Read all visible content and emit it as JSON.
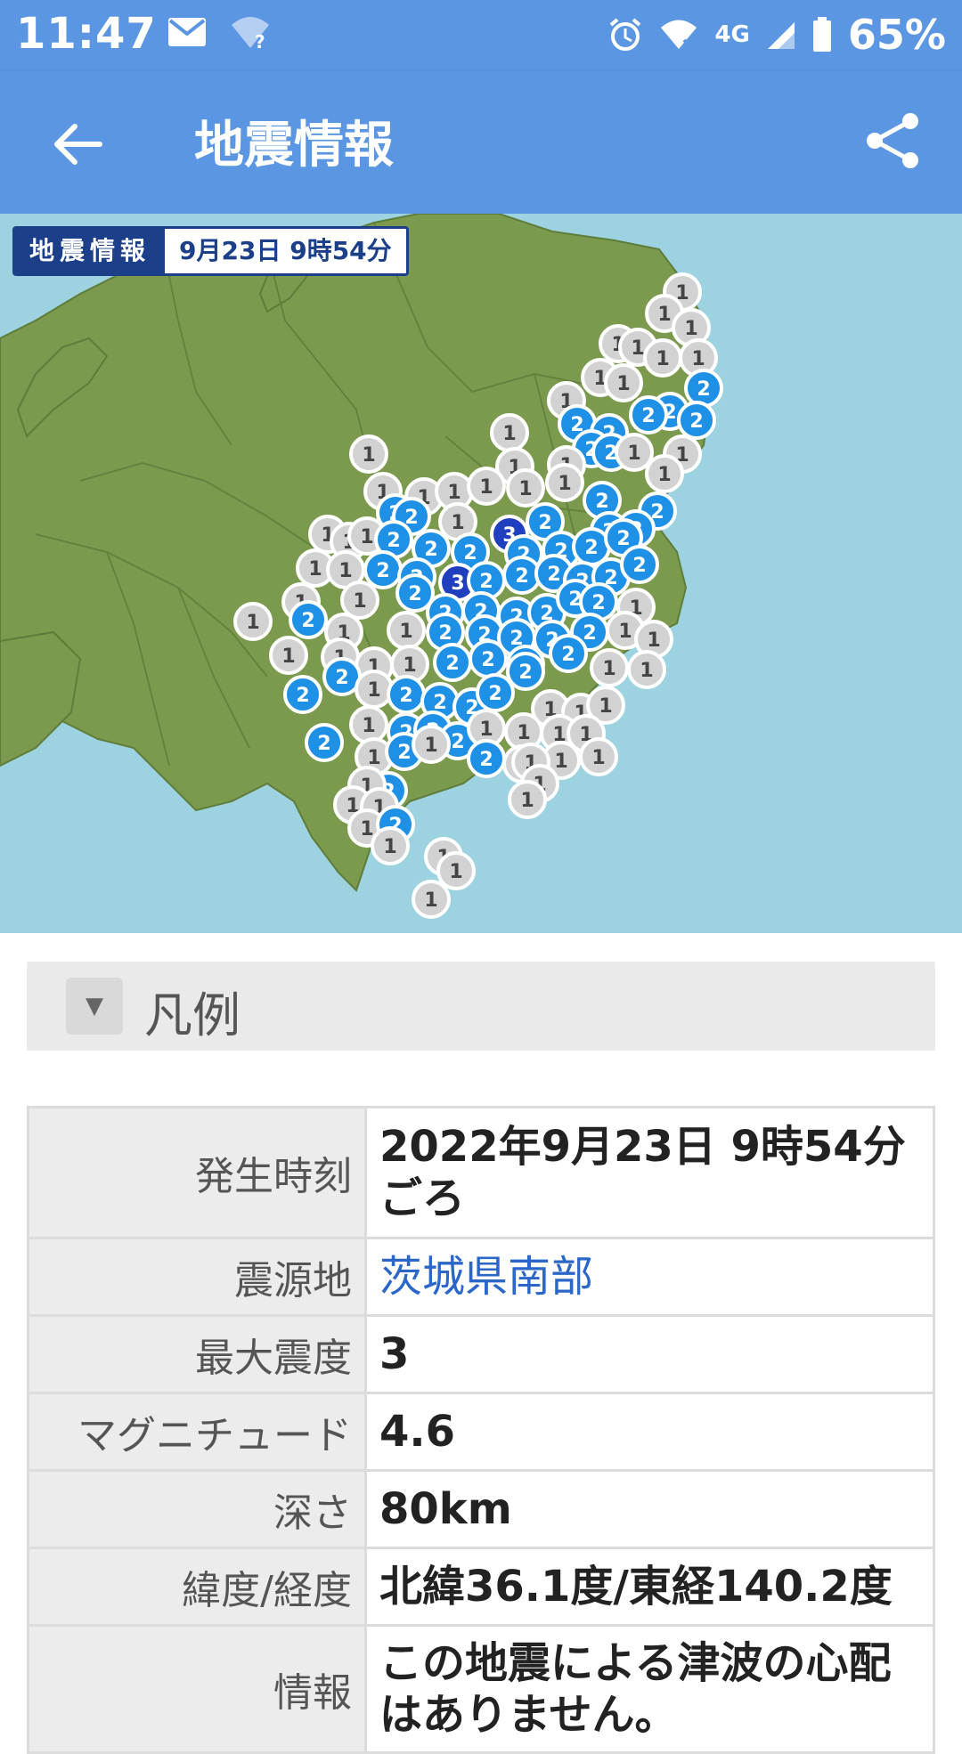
{
  "status_bar": {
    "time": "11:47",
    "network": "4G",
    "battery": "65%"
  },
  "app_bar": {
    "title": "地震情報"
  },
  "map": {
    "label_title": "地震情報",
    "label_datetime": "9月23日 9時54分"
  },
  "legend": {
    "label": "凡例"
  },
  "details": [
    {
      "label": "発生時刻",
      "value": "2022年9月23日 9時54分ごろ"
    },
    {
      "label": "震源地",
      "value": "茨城県南部"
    },
    {
      "label": "最大震度",
      "value": "3"
    },
    {
      "label": "マグニチュード",
      "value": "4.6"
    },
    {
      "label": "深さ",
      "value": "80km"
    },
    {
      "label": "緯度/経度",
      "value": "北緯36.1度/東経140.2度"
    },
    {
      "label": "情報",
      "value": "この地震による津波の心配はありません。"
    }
  ],
  "intensity_markers": {
    "levels": [
      "1",
      "2",
      "3"
    ],
    "colors": {
      "1": "#d2d2d2",
      "2": "#1e90e6",
      "3": "#1f3fbf"
    }
  }
}
